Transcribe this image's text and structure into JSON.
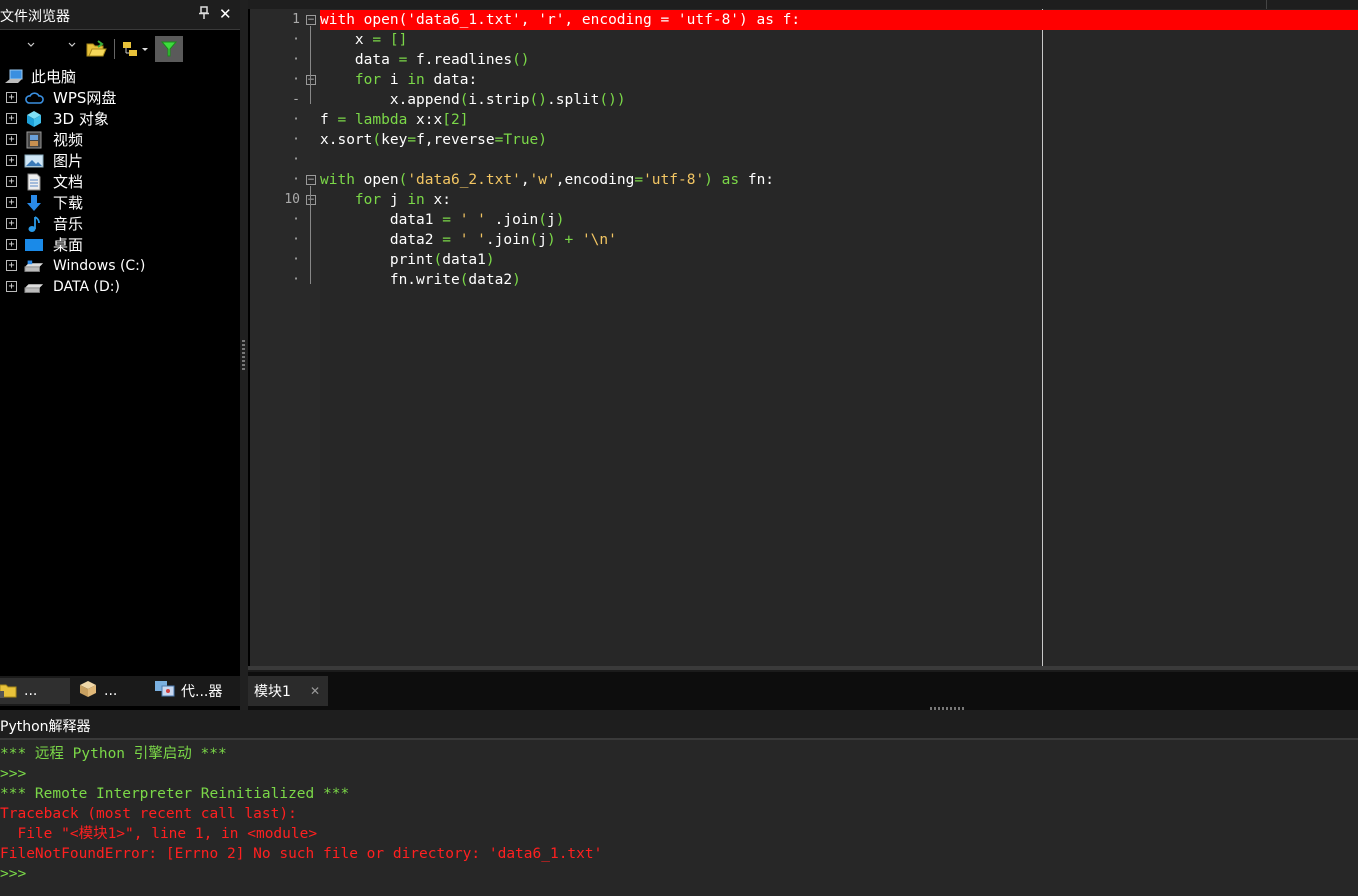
{
  "file_browser": {
    "title": "文件浏览器",
    "pin_icon": "pin-icon",
    "close_label": "✕",
    "tree": [
      {
        "label": "此电脑",
        "icon": "computer-icon",
        "expandable": false
      },
      {
        "label": "WPS网盘",
        "icon": "cloud-icon",
        "expandable": true
      },
      {
        "label": "3D 对象",
        "icon": "cube-icon",
        "expandable": true
      },
      {
        "label": "视频",
        "icon": "film-icon",
        "expandable": true
      },
      {
        "label": "图片",
        "icon": "picture-icon",
        "expandable": true
      },
      {
        "label": "文档",
        "icon": "document-icon",
        "expandable": true
      },
      {
        "label": "下载",
        "icon": "download-arrow-icon",
        "expandable": true
      },
      {
        "label": "音乐",
        "icon": "music-note-icon",
        "expandable": true
      },
      {
        "label": "桌面",
        "icon": "desktop-icon",
        "expandable": true
      },
      {
        "label": "Windows (C:)",
        "icon": "drive-icon",
        "expandable": true
      },
      {
        "label": "DATA (D:)",
        "icon": "drive-icon",
        "expandable": true
      }
    ],
    "tabs": [
      {
        "label": "...",
        "icon": "folder-tab-icon"
      },
      {
        "label": "...",
        "icon": "box-tab-icon"
      },
      {
        "label": "代...器",
        "icon": "code-browser-icon"
      }
    ],
    "expand_glyph": "+"
  },
  "editor": {
    "gutter_numbers": [
      "1",
      "·",
      "·",
      "·",
      "-",
      "·",
      "·",
      "·",
      "·",
      "10",
      "·",
      "·",
      "·",
      "·"
    ],
    "lines": [
      [
        {
          "t": "with open('data6_1.txt', 'r', encoding = 'utf-8') as f:",
          "c": ""
        }
      ],
      [
        {
          "t": "    x ",
          "c": ""
        },
        {
          "t": "=",
          "c": "op"
        },
        {
          "t": " ",
          "c": ""
        },
        {
          "t": "[]",
          "c": "op"
        }
      ],
      [
        {
          "t": "    data ",
          "c": ""
        },
        {
          "t": "=",
          "c": "op"
        },
        {
          "t": " f.readlines",
          "c": ""
        },
        {
          "t": "()",
          "c": "op"
        }
      ],
      [
        {
          "t": "    ",
          "c": ""
        },
        {
          "t": "for",
          "c": "kw"
        },
        {
          "t": " i ",
          "c": ""
        },
        {
          "t": "in",
          "c": "kw"
        },
        {
          "t": " data:",
          "c": ""
        }
      ],
      [
        {
          "t": "        x.append",
          "c": ""
        },
        {
          "t": "(",
          "c": "op"
        },
        {
          "t": "i.strip",
          "c": ""
        },
        {
          "t": "()",
          "c": "op"
        },
        {
          "t": ".split",
          "c": ""
        },
        {
          "t": "())",
          "c": "op"
        }
      ],
      [
        {
          "t": "f ",
          "c": ""
        },
        {
          "t": "=",
          "c": "op"
        },
        {
          "t": " ",
          "c": ""
        },
        {
          "t": "lambda",
          "c": "kw"
        },
        {
          "t": " x:x",
          "c": ""
        },
        {
          "t": "[2]",
          "c": "op"
        }
      ],
      [
        {
          "t": "x.sort",
          "c": ""
        },
        {
          "t": "(",
          "c": "op"
        },
        {
          "t": "key",
          "c": ""
        },
        {
          "t": "=",
          "c": "op"
        },
        {
          "t": "f,reverse",
          "c": ""
        },
        {
          "t": "=True)",
          "c": "op"
        }
      ],
      [
        {
          "t": "",
          "c": ""
        }
      ],
      [
        {
          "t": "with",
          "c": "kw"
        },
        {
          "t": " open",
          "c": ""
        },
        {
          "t": "(",
          "c": "op"
        },
        {
          "t": "'data6_2.txt'",
          "c": "str"
        },
        {
          "t": ",",
          "c": ""
        },
        {
          "t": "'w'",
          "c": "str"
        },
        {
          "t": ",encoding",
          "c": ""
        },
        {
          "t": "=",
          "c": "op"
        },
        {
          "t": "'utf-8'",
          "c": "str"
        },
        {
          "t": ") ",
          "c": "op"
        },
        {
          "t": "as",
          "c": "kw"
        },
        {
          "t": " fn:",
          "c": ""
        }
      ],
      [
        {
          "t": "    ",
          "c": ""
        },
        {
          "t": "for",
          "c": "kw"
        },
        {
          "t": " j ",
          "c": ""
        },
        {
          "t": "in",
          "c": "kw"
        },
        {
          "t": " x:",
          "c": ""
        }
      ],
      [
        {
          "t": "        data1 ",
          "c": ""
        },
        {
          "t": "=",
          "c": "op"
        },
        {
          "t": " ",
          "c": ""
        },
        {
          "t": "' '",
          "c": "str"
        },
        {
          "t": " .join",
          "c": ""
        },
        {
          "t": "(",
          "c": "op"
        },
        {
          "t": "j",
          "c": ""
        },
        {
          "t": ")",
          "c": "op"
        }
      ],
      [
        {
          "t": "        data2 ",
          "c": ""
        },
        {
          "t": "=",
          "c": "op"
        },
        {
          "t": " ",
          "c": ""
        },
        {
          "t": "' '",
          "c": "str"
        },
        {
          "t": ".join",
          "c": ""
        },
        {
          "t": "(",
          "c": "op"
        },
        {
          "t": "j",
          "c": ""
        },
        {
          "t": ") + ",
          "c": "op"
        },
        {
          "t": "'\\n'",
          "c": "str"
        }
      ],
      [
        {
          "t": "        print",
          "c": ""
        },
        {
          "t": "(",
          "c": "op"
        },
        {
          "t": "data1",
          "c": ""
        },
        {
          "t": ")",
          "c": "op"
        }
      ],
      [
        {
          "t": "        fn.write",
          "c": ""
        },
        {
          "t": "(",
          "c": "op"
        },
        {
          "t": "data2",
          "c": ""
        },
        {
          "t": ")",
          "c": "op"
        }
      ]
    ],
    "highlight_color": "#ff0000",
    "tab_label": "模块1",
    "tab_close": "✕"
  },
  "interpreter": {
    "title": "Python解释器",
    "output": [
      {
        "text": "*** 远程 Python 引擎启动 ***",
        "color": "green"
      },
      {
        "text": ">>> ",
        "color": "green"
      },
      {
        "text": "*** Remote Interpreter Reinitialized ***",
        "color": "green"
      },
      {
        "text": "Traceback (most recent call last):",
        "color": "red"
      },
      {
        "text": "  File \"<模块1>\", line 1, in <module>",
        "color": "red"
      },
      {
        "text": "FileNotFoundError: [Errno 2] No such file or directory: 'data6_1.txt'",
        "color": "red"
      },
      {
        "text": ">>> ",
        "color": "green"
      }
    ]
  },
  "colors": {
    "keyword": "#7bd848",
    "string": "#f3c663",
    "error": "#ff2020",
    "filter_button": "#5a5a5a"
  }
}
